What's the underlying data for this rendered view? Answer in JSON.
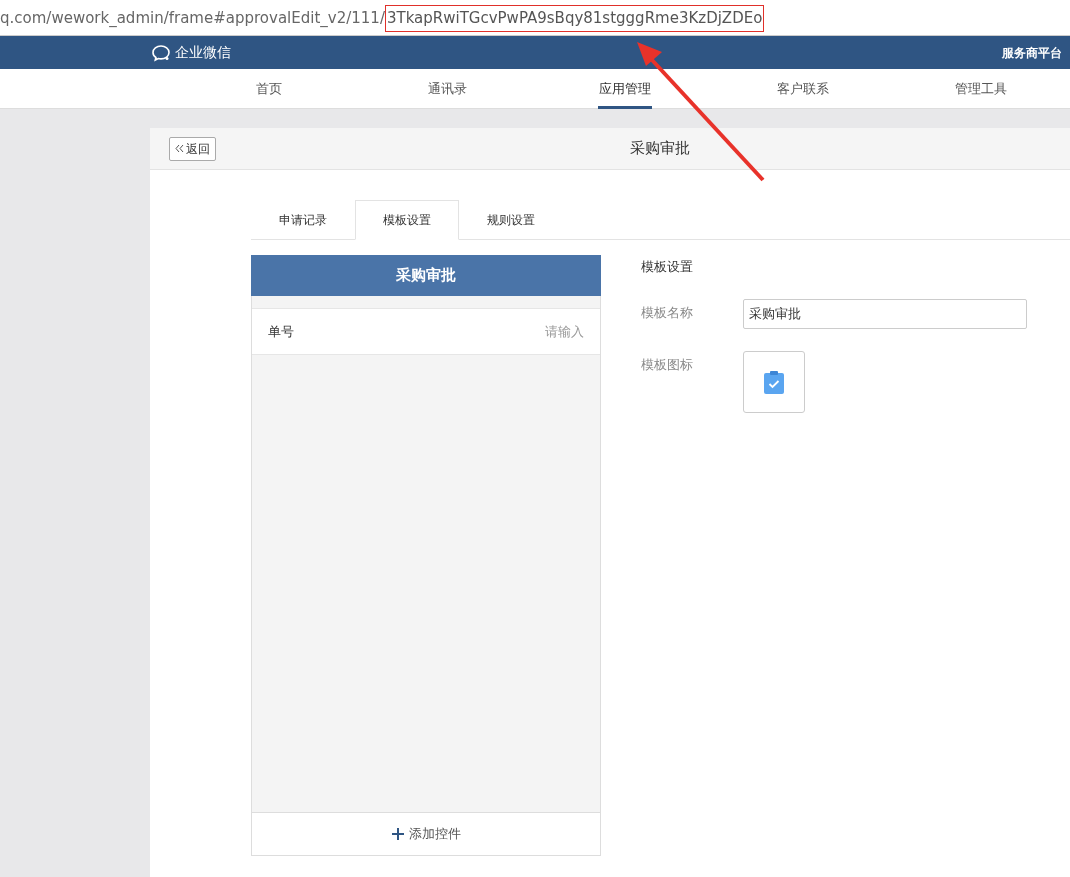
{
  "address_bar": {
    "url": "q.com/wework_admin/frame#approvalEdit_v2/111/",
    "highlighted_part": "3TkapRwiTGcvPwPA9sBqy81stgggRme3KzDjZDEo"
  },
  "header": {
    "logo_text": "企业微信",
    "right_link": "服务商平台"
  },
  "nav": [
    {
      "label": "首页",
      "selected": false
    },
    {
      "label": "通讯录",
      "selected": false
    },
    {
      "label": "应用管理",
      "selected": true
    },
    {
      "label": "客户联系",
      "selected": false
    },
    {
      "label": "管理工具",
      "selected": false
    }
  ],
  "panel": {
    "back_button": "返回",
    "title": "采购审批"
  },
  "tabs": [
    {
      "label": "申请记录",
      "selected": false
    },
    {
      "label": "模板设置",
      "selected": true
    },
    {
      "label": "规则设置",
      "selected": false
    }
  ],
  "preview": {
    "title": "采购审批",
    "fields": [
      {
        "label": "单号",
        "placeholder": "请输入"
      }
    ],
    "add_button": "添加控件"
  },
  "settings": {
    "heading": "模板设置",
    "name_label": "模板名称",
    "name_value": "采购审批",
    "icon_label": "模板图标"
  }
}
